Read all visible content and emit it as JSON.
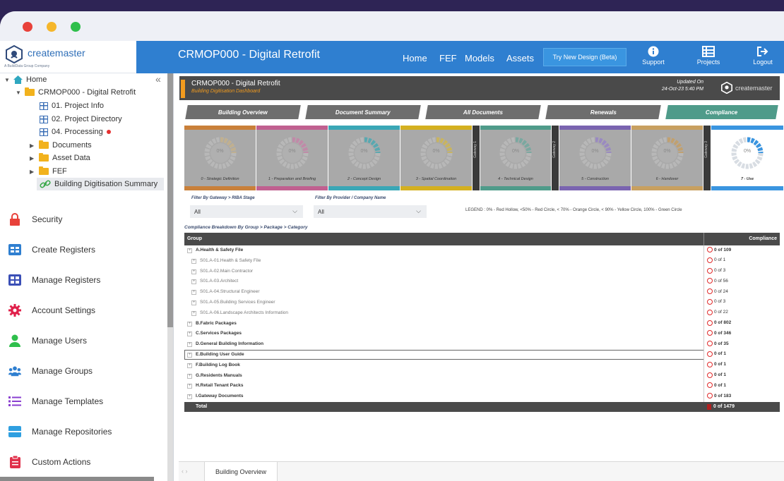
{
  "app": {
    "logo_text": "createmaster",
    "logo_sub": "A BuildData Group Company",
    "project_title": "CRMOP000 - Digital Retrofit"
  },
  "nav": {
    "home": "Home",
    "fef": "FEF",
    "models": "Models",
    "assets": "Assets",
    "try_button": "Try New Design (Beta)",
    "support": "Support",
    "projects": "Projects",
    "logout": "Logout"
  },
  "tree": {
    "home": "Home",
    "project": "CRMOP000 - Digital Retrofit",
    "project_info": "01. Project Info",
    "project_directory": "02. Project Directory",
    "processing": "04. Processing",
    "documents": "Documents",
    "asset_data": "Asset Data",
    "fef": "FEF",
    "summary": "Building Digitisation Summary",
    "collapse_glyph": "«"
  },
  "menu": [
    {
      "label": "Security",
      "icon": "lock-icon",
      "color": "#e8413a"
    },
    {
      "label": "Create Registers",
      "icon": "register-icon",
      "color": "#2f7fd0"
    },
    {
      "label": "Manage Registers",
      "icon": "register-grid-icon",
      "color": "#3b4fb6"
    },
    {
      "label": "Account Settings",
      "icon": "gear-icon",
      "color": "#e0204a"
    },
    {
      "label": "Manage Users",
      "icon": "user-icon",
      "color": "#2fbf4c"
    },
    {
      "label": "Manage Groups",
      "icon": "group-icon",
      "color": "#2f7fd0"
    },
    {
      "label": "Manage Templates",
      "icon": "list-icon",
      "color": "#8a3fd0"
    },
    {
      "label": "Manage Repositories",
      "icon": "repository-icon",
      "color": "#2f9fe0"
    },
    {
      "label": "Custom Actions",
      "icon": "clipboard-icon",
      "color": "#e0304a"
    }
  ],
  "dashboard": {
    "title": "CRMOP000 - Digital Retrofit",
    "subtitle": "Building Digitisation Dashboard",
    "updated_label": "Updated On",
    "updated_value": "24-Oct-23 5:40 PM",
    "logo_text": "createmaster"
  },
  "tabs": [
    {
      "label": "Building Overview",
      "active": false
    },
    {
      "label": "Document Summary",
      "active": false
    },
    {
      "label": "All Documents",
      "active": false
    },
    {
      "label": "Renewals",
      "active": false
    },
    {
      "label": "Compliance",
      "active": true
    }
  ],
  "stages": [
    {
      "label": "0 - Strategic Definition",
      "value": "0%",
      "color": "#c9803a",
      "ring": "#c0b090"
    },
    {
      "label": "1 - Preparation and Briefing",
      "value": "0%",
      "color": "#c06090",
      "ring": "#c08aa8"
    },
    {
      "label": "2 - Concept Design",
      "value": "0%",
      "color": "#3aa7b6",
      "ring": "#5aa8b0"
    },
    {
      "label": "3 - Spatial Coordination",
      "value": "0%",
      "color": "#d4b020",
      "ring": "#c8b460"
    },
    {
      "label": "4 - Technical Design",
      "value": "0%",
      "color": "#4f9b8a",
      "ring": "#7aa8a0"
    },
    {
      "label": "5 - Construction",
      "value": "0%",
      "color": "#7a64b0",
      "ring": "#9a8ac0"
    },
    {
      "label": "6 - Handover",
      "value": "0%",
      "color": "#c8a060",
      "ring": "#c0a070"
    },
    {
      "label": "7 - Use",
      "value": "0%",
      "color": "#3a95e0",
      "ring": "#3a95e0"
    }
  ],
  "gateways": [
    "Gateway 1",
    "Gateway 2",
    "Gateway 3"
  ],
  "filters": {
    "gateway_label": "Filter By Gateway > RIBA Stage",
    "gateway_value": "All",
    "provider_label": "Filter By Provider / Company Name",
    "provider_value": "All",
    "legend": "LEGEND :  0% - Red Hollow,  <50% - Red Circle,  < 70% - Orange Circle,  < 90% - Yellow Circle,  100% - Green Circle"
  },
  "breakdown": {
    "title": "Compliance Breakdown By Group > Package > Category",
    "col_group": "Group",
    "col_compliance": "Compliance",
    "rows": [
      {
        "name": "A.Health & Safety File",
        "value": "0 of 109",
        "level": "group"
      },
      {
        "name": "S01.A-01.Health & Safety File",
        "value": "0 of 1",
        "level": "sub"
      },
      {
        "name": "S01.A-02.Main Contractor",
        "value": "0 of 3",
        "level": "sub"
      },
      {
        "name": "S01.A-03.Architect",
        "value": "0 of 56",
        "level": "sub"
      },
      {
        "name": "S01.A-04.Structural Engineer",
        "value": "0 of 24",
        "level": "sub"
      },
      {
        "name": "S01.A-05.Building Services Engineer",
        "value": "0 of 3",
        "level": "sub"
      },
      {
        "name": "S01.A-06.Landscape Architects Information",
        "value": "0 of 22",
        "level": "sub"
      },
      {
        "name": "B.Fabric Packages",
        "value": "0 of 802",
        "level": "group"
      },
      {
        "name": "C.Services Packages",
        "value": "0 of 346",
        "level": "group"
      },
      {
        "name": "D.General Building Information",
        "value": "0 of 35",
        "level": "group"
      },
      {
        "name": "E.Building User Guide",
        "value": "0 of 1",
        "level": "group",
        "highlight": true
      },
      {
        "name": "F.Building Log Book",
        "value": "0 of 1",
        "level": "group"
      },
      {
        "name": "G.Residents Manuals",
        "value": "0 of 1",
        "level": "group"
      },
      {
        "name": "H.Retail Tenant Packs",
        "value": "0 of 1",
        "level": "group"
      },
      {
        "name": "I.Gateway Documents",
        "value": "0 of 183",
        "level": "group"
      }
    ],
    "total_label": "Total",
    "total_value": "0 of 1479"
  },
  "bottom_tabs": {
    "nav": "‹  ›",
    "active": "Building Overview"
  }
}
